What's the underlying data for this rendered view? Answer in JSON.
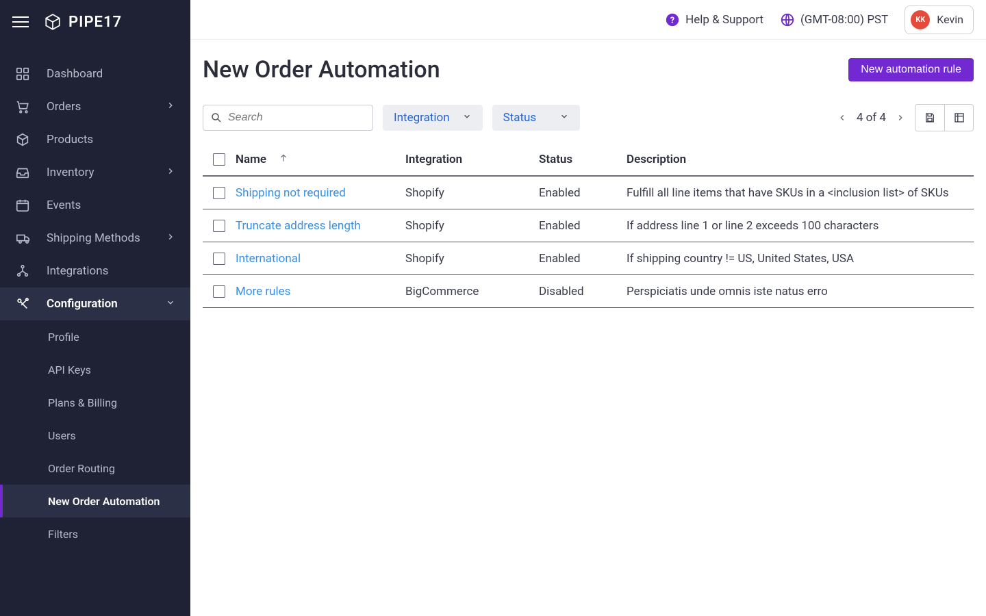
{
  "brand": {
    "name": "PIPE17"
  },
  "header": {
    "help": "Help & Support",
    "timezone": "(GMT-08:00) PST",
    "user": {
      "initials": "KK",
      "name": "Kevin"
    }
  },
  "sidebar": {
    "items": [
      {
        "label": "Dashboard"
      },
      {
        "label": "Orders"
      },
      {
        "label": "Products"
      },
      {
        "label": "Inventory"
      },
      {
        "label": "Events"
      },
      {
        "label": "Shipping Methods"
      },
      {
        "label": "Integrations"
      },
      {
        "label": "Configuration"
      }
    ],
    "sub": [
      {
        "label": "Profile"
      },
      {
        "label": "API Keys"
      },
      {
        "label": "Plans & Billing"
      },
      {
        "label": "Users"
      },
      {
        "label": "Order Routing"
      },
      {
        "label": "New Order Automation"
      },
      {
        "label": "Filters"
      }
    ]
  },
  "page": {
    "title": "New Order Automation",
    "new_button": "New automation rule",
    "search_placeholder": "Search",
    "filter_integration": "Integration",
    "filter_status": "Status",
    "pager": "4 of 4"
  },
  "table": {
    "columns": {
      "name": "Name",
      "integration": "Integration",
      "status": "Status",
      "description": "Description"
    },
    "rows": [
      {
        "name": "Shipping not required",
        "integration": "Shopify",
        "status": "Enabled",
        "description": "Fulfill all line items that have SKUs in a <inclusion list> of SKUs"
      },
      {
        "name": "Truncate address length",
        "integration": "Shopify",
        "status": "Enabled",
        "description": "If address line 1 or line 2 exceeds 100 characters"
      },
      {
        "name": "International",
        "integration": "Shopify",
        "status": "Enabled",
        "description": "If shipping country != US, United States, USA"
      },
      {
        "name": "More rules",
        "integration": "BigCommerce",
        "status": "Disabled",
        "description": "Perspiciatis unde omnis iste natus erro"
      }
    ]
  }
}
